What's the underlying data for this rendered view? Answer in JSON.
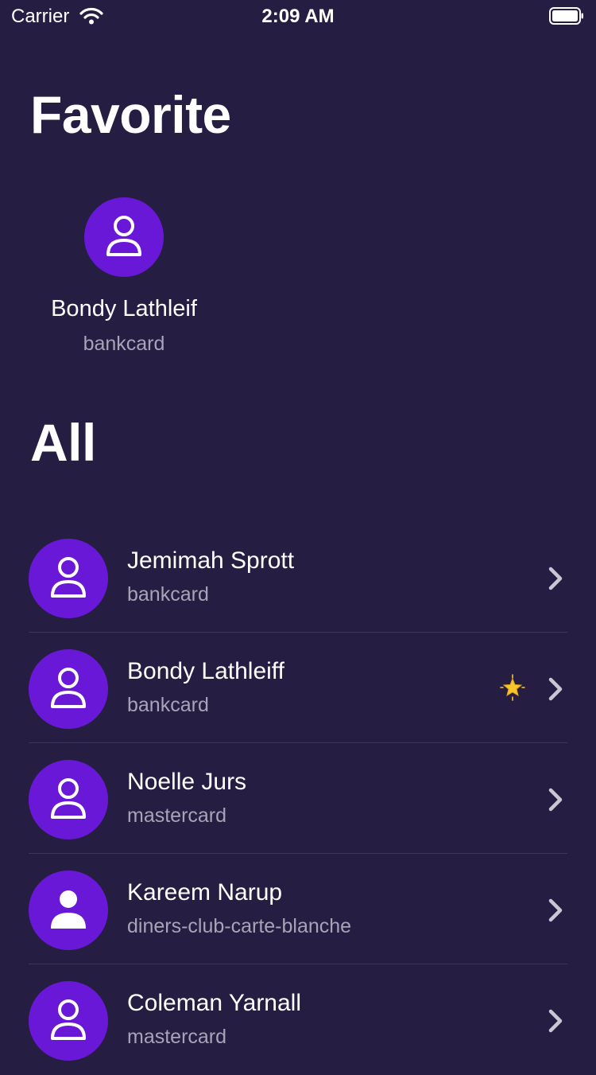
{
  "status_bar": {
    "carrier": "Carrier",
    "time": "2:09 AM",
    "icons": [
      "wifi-icon",
      "battery-icon"
    ]
  },
  "favorites": {
    "title": "Favorite",
    "items": [
      {
        "name": "Bondy Lathleif",
        "card_type": "bankcard",
        "icon": "person-outline-icon"
      }
    ]
  },
  "all": {
    "title": "All",
    "items": [
      {
        "name": "Jemimah Sprott",
        "card_type": "bankcard",
        "icon": "person-outline-icon",
        "favorite": false
      },
      {
        "name": "Bondy Lathleiff",
        "card_type": "bankcard",
        "icon": "person-outline-icon",
        "favorite": true
      },
      {
        "name": "Noelle Jurs",
        "card_type": "mastercard",
        "icon": "person-outline-icon",
        "favorite": false
      },
      {
        "name": "Kareem Narup",
        "card_type": "diners-club-carte-blanche",
        "icon": "person-filled-icon",
        "favorite": false
      },
      {
        "name": "Coleman Yarnall",
        "card_type": "mastercard",
        "icon": "person-outline-icon",
        "favorite": false
      }
    ]
  },
  "colors": {
    "background": "#251E42",
    "avatar": "#6A18D8",
    "secondary_text": "#A7A4B8",
    "divider": "#3D3658",
    "star": "#F6C52B"
  }
}
